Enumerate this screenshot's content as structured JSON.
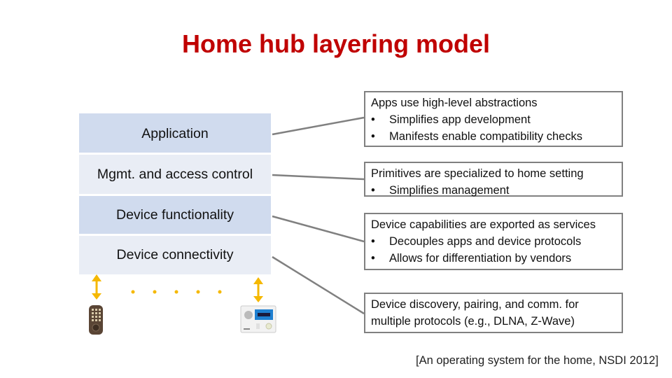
{
  "title": "Home hub layering model",
  "layers": [
    {
      "label": "Application",
      "shade": "dark"
    },
    {
      "label": "Mgmt. and access control",
      "shade": "light"
    },
    {
      "label": "Device functionality",
      "shade": "dark"
    },
    {
      "label": "Device connectivity",
      "shade": "light"
    }
  ],
  "notes": [
    {
      "heading": "Apps use high-level abstractions",
      "bullets": [
        "Simplifies app development",
        "Manifests enable compatibility checks"
      ]
    },
    {
      "heading": "Primitives are specialized to home setting",
      "bullets": [
        "Simplifies management"
      ]
    },
    {
      "heading": "Device capabilities are exported as services",
      "bullets": [
        "Decouples apps and device protocols",
        "Allows for differentiation by vendors"
      ]
    },
    {
      "heading": "Device discovery, pairing, and comm. for",
      "heading2": "multiple protocols (e.g., DLNA, Z-Wave)",
      "bullets": []
    }
  ],
  "bullet_char": "•",
  "devices": [
    {
      "name": "smart-lock"
    },
    {
      "name": "security-panel"
    }
  ],
  "ellipsis_dots": 5,
  "citation": "[An operating system for the home, NSDI 2012]",
  "colors": {
    "title": "#C00000",
    "layer_dark": "#D0DBEE",
    "layer_light": "#E9EDF5",
    "connector": "#808080",
    "arrow": "#F5B800"
  }
}
